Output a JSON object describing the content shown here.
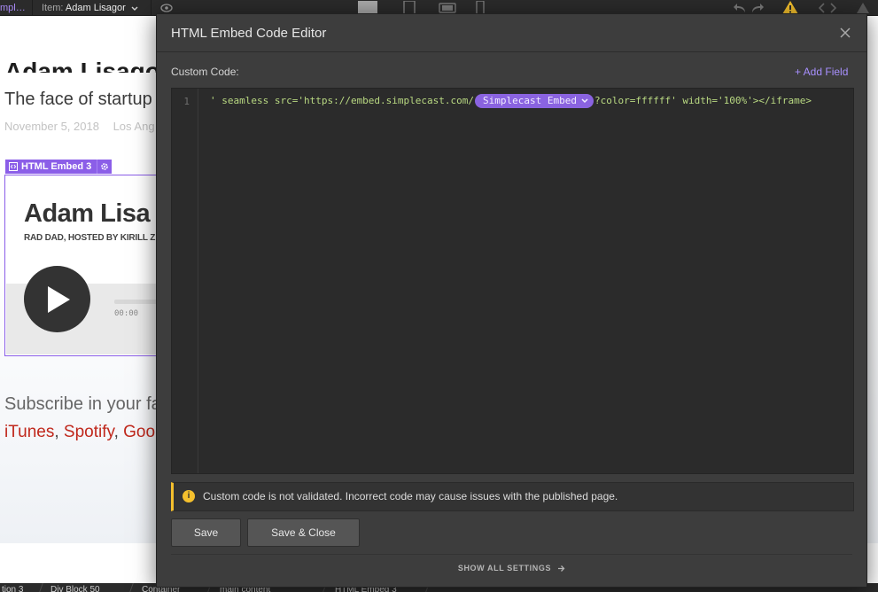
{
  "topbar": {
    "page_crumb": "mpl…",
    "item_label": "Item:",
    "item_value": "Adam Lisagor"
  },
  "canvas": {
    "post_title": "Adam Lisagor",
    "post_subtitle": "The face of startup",
    "post_date": "November 5, 2018",
    "post_location": "Los Ang",
    "embed_label": "HTML Embed 3",
    "player_title": "Adam Lisa",
    "player_subtitle": "RAD DAD, HOSTED BY KIRILL Z",
    "player_time": "00:00",
    "subscribe_text": "Subscribe in your fa",
    "links": [
      "iTunes",
      "Spotify",
      "Goo"
    ],
    "links_sep": ", "
  },
  "bottombar": {
    "crumbs": [
      "tion 3",
      "Div Block 50",
      "Container",
      "main content",
      "HTML Embed 3"
    ]
  },
  "modal": {
    "title": "HTML Embed Code Editor",
    "field_label": "Custom Code:",
    "add_field": "+ Add Field",
    "line_number": "1",
    "code": {
      "before": "' seamless src='https://embed.simplecast.com/",
      "token_label": "Simplecast Embed",
      "after": "?color=ffffff' width='100%'></iframe>"
    },
    "notice_icon": "i",
    "notice": "Custom code is not validated. Incorrect code may cause issues with the published page.",
    "save": "Save",
    "save_close": "Save & Close",
    "show_all": "SHOW ALL SETTINGS"
  },
  "colors": {
    "accent_purple": "#8b5ee8",
    "warning_yellow": "#f5c02d",
    "link_red": "#c0281c",
    "modal_bg": "#3d3d3d"
  },
  "icons": [
    "eye-icon",
    "chevron-down-icon",
    "desktop-icon",
    "tablet-icon",
    "phone-landscape-icon",
    "phone-portrait-icon",
    "undo-icon",
    "redo-icon",
    "warning-icon",
    "code-icon",
    "close-icon",
    "gear-icon",
    "embed-icon",
    "play-icon",
    "info-icon",
    "arrow-right-icon"
  ]
}
